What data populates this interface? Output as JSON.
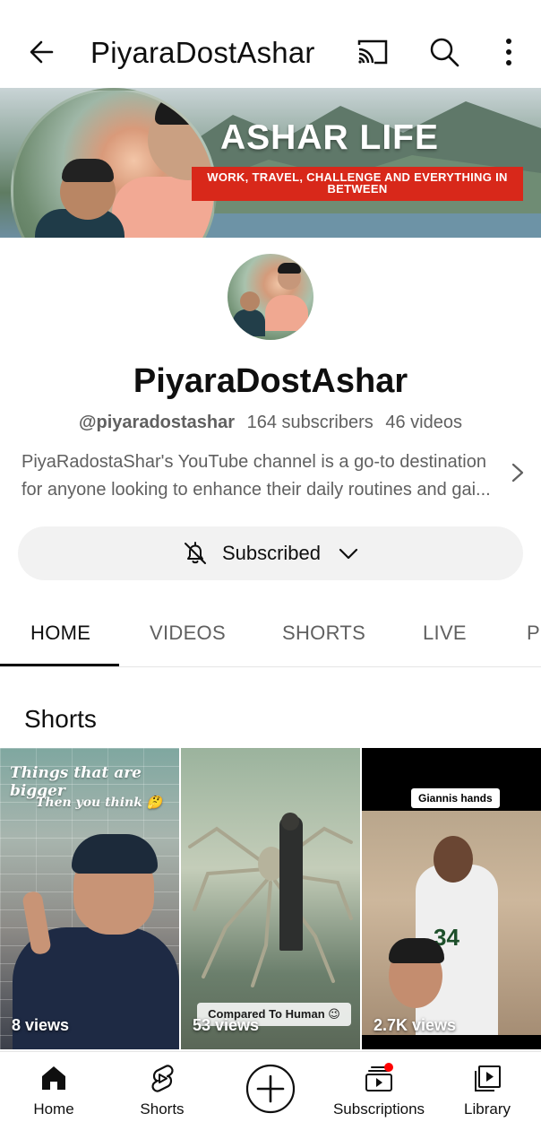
{
  "appbar": {
    "title": "PiyaraDostAshar",
    "icons": [
      "back-arrow-icon",
      "cast-icon",
      "search-icon",
      "more-vertical-icon"
    ]
  },
  "banner": {
    "title": "ASHAR LIFE",
    "tagline": "WORK, TRAVEL, CHALLENGE AND EVERYTHING IN BETWEEN"
  },
  "channel": {
    "name": "PiyaraDostAshar",
    "handle": "@piyaradostashar",
    "subscribers": "164 subscribers",
    "videos": "46 videos",
    "description_line1": "PiyaRadostaShar's YouTube channel is a go-to destination",
    "description_line2": "for anyone looking to enhance their daily routines and gai..."
  },
  "subscribe": {
    "label": "Subscribed"
  },
  "tabs": [
    {
      "label": "HOME",
      "active": true
    },
    {
      "label": "VIDEOS",
      "active": false
    },
    {
      "label": "SHORTS",
      "active": false
    },
    {
      "label": "LIVE",
      "active": false
    },
    {
      "label": "P",
      "active": false
    }
  ],
  "section": {
    "title": "Shorts"
  },
  "shorts": [
    {
      "overlay_line1": "Things that are bigger",
      "overlay_line2": "Then you think 🤔",
      "views": "8 views"
    },
    {
      "caption": "Compared To Human 😉",
      "views": "53 views"
    },
    {
      "label": "Giannis hands",
      "jersey": "34",
      "views": "2.7K views"
    }
  ],
  "bottom_nav": [
    {
      "label": "Home",
      "icon": "home-icon"
    },
    {
      "label": "Shorts",
      "icon": "shorts-icon"
    },
    {
      "label": "",
      "icon": "create-plus-icon"
    },
    {
      "label": "Subscriptions",
      "icon": "subscriptions-icon"
    },
    {
      "label": "Library",
      "icon": "library-icon"
    }
  ],
  "colors": {
    "text_primary": "#0f0f0f",
    "text_secondary": "#606060",
    "banner_tag_bg": "#d8281a",
    "notification_dot": "#ff0000",
    "button_bg": "#f2f2f2"
  }
}
